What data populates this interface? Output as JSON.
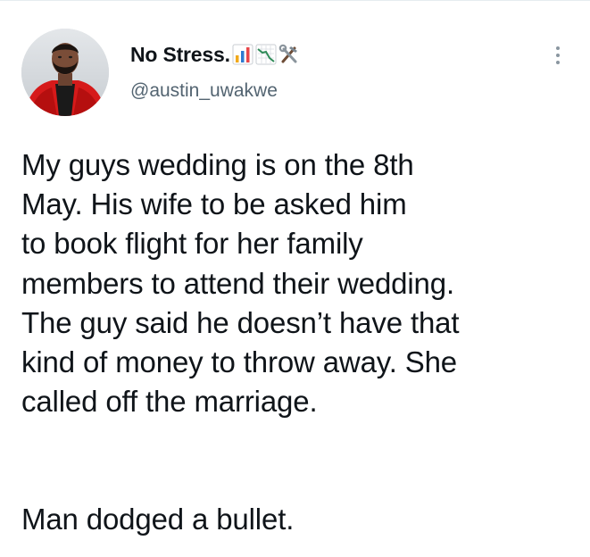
{
  "tweet": {
    "author": {
      "display_name": "No Stress.",
      "name_emojis": [
        "bar-chart-emoji",
        "chart-decreasing-emoji",
        "hammer-and-wrench-emoji"
      ],
      "handle": "@austin_uwakwe",
      "avatar": "profile-photo"
    },
    "more_icon": "more-options-vertical-icon",
    "body": {
      "paragraph_1_lines": [
        "My guys wedding is on the 8th",
        "May. His wife to be asked him",
        "to book flight for her family",
        "members to attend their wedding.",
        "The guy said he doesn’t have that",
        "kind of money to throw away. She",
        "called off the marriage."
      ],
      "paragraph_2": "Man dodged a bullet."
    }
  },
  "colors": {
    "text_primary": "#0f1419",
    "text_secondary": "#536471",
    "divider": "#e6ecf0",
    "more_dots": "#8a96a0"
  }
}
